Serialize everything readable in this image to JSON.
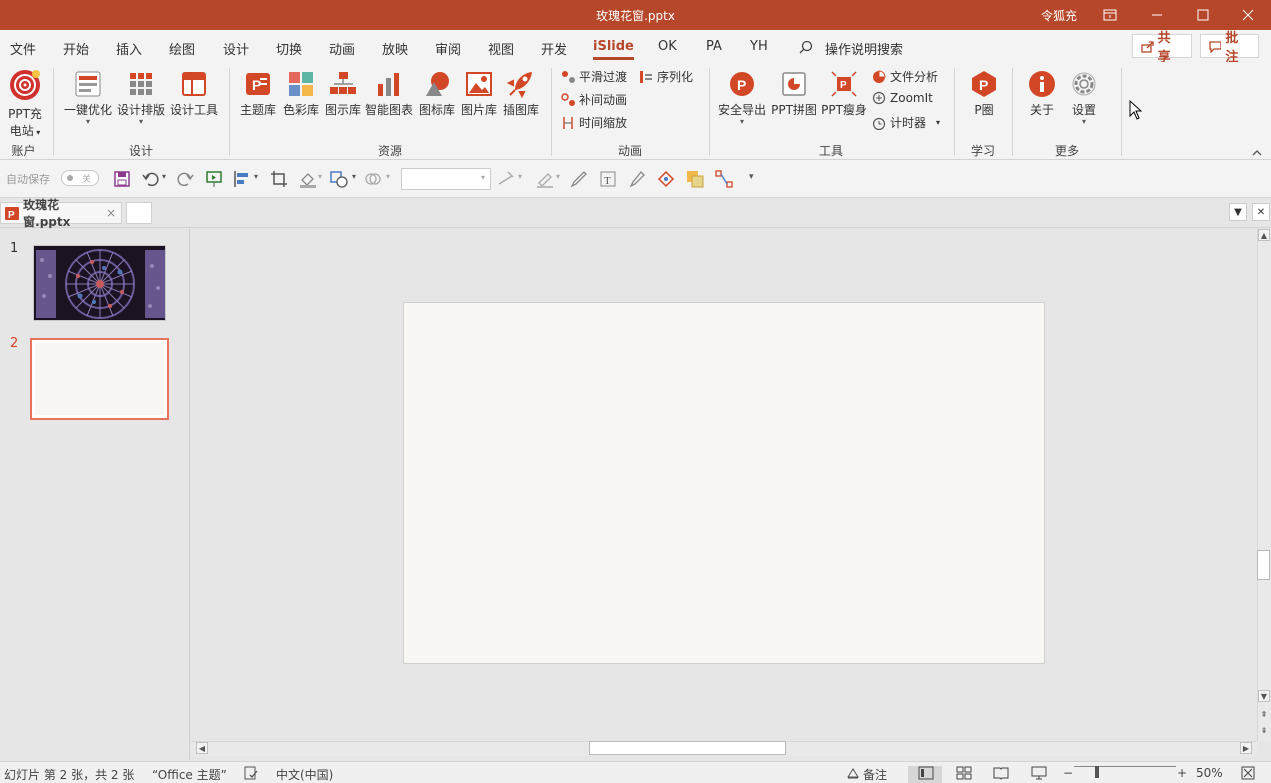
{
  "window": {
    "title": "玫瑰花窗.pptx",
    "user": "令狐充"
  },
  "menu": {
    "tabs": [
      "文件",
      "开始",
      "插入",
      "绘图",
      "设计",
      "切换",
      "动画",
      "放映",
      "审阅",
      "视图",
      "开发",
      "iSlide",
      "OK",
      "PA",
      "YH"
    ],
    "active_tab": "iSlide",
    "search_label": "操作说明搜索",
    "share_label": "共享",
    "comment_label": "批注"
  },
  "ribbon": {
    "account": {
      "button": "PPT充电站",
      "button_line1": "PPT充",
      "button_line2": "电站",
      "group": "账户"
    },
    "design": {
      "buttons": [
        "一键优化",
        "设计排版",
        "设计工具"
      ],
      "group": "设计"
    },
    "resources": {
      "buttons": [
        "主题库",
        "色彩库",
        "图示库",
        "智能图表",
        "图标库",
        "图片库",
        "插图库"
      ],
      "group": "资源"
    },
    "animation": {
      "buttons": [
        "平滑过渡",
        "补间动画",
        "时间缩放",
        "序列化"
      ],
      "group": "动画"
    },
    "tools": {
      "buttons": [
        "安全导出",
        "PPT拼图",
        "PPT瘦身",
        "文件分析",
        "ZoomIt",
        "计时器"
      ],
      "group": "工具"
    },
    "learn": {
      "buttons": [
        "P圈"
      ],
      "group": "学习"
    },
    "more": {
      "buttons": [
        "关于",
        "设置"
      ],
      "group": "更多"
    }
  },
  "qat": {
    "autosave_label": "自动保存",
    "autosave_state": "关",
    "font_value": ""
  },
  "doc_tabs": [
    {
      "label": "玫瑰花窗.pptx",
      "close": "×"
    }
  ],
  "slides": [
    {
      "number": "1",
      "selected": false
    },
    {
      "number": "2",
      "selected": true
    }
  ],
  "status": {
    "slide_info": "幻灯片 第 2 张，共 2 张",
    "theme": "“Office 主题”",
    "language": "中文(中国)",
    "notes": "备注",
    "zoom": "50%",
    "zoom_fraction": 0.5
  },
  "colors": {
    "accent": "#b7472a",
    "selection": "#e8735a"
  }
}
